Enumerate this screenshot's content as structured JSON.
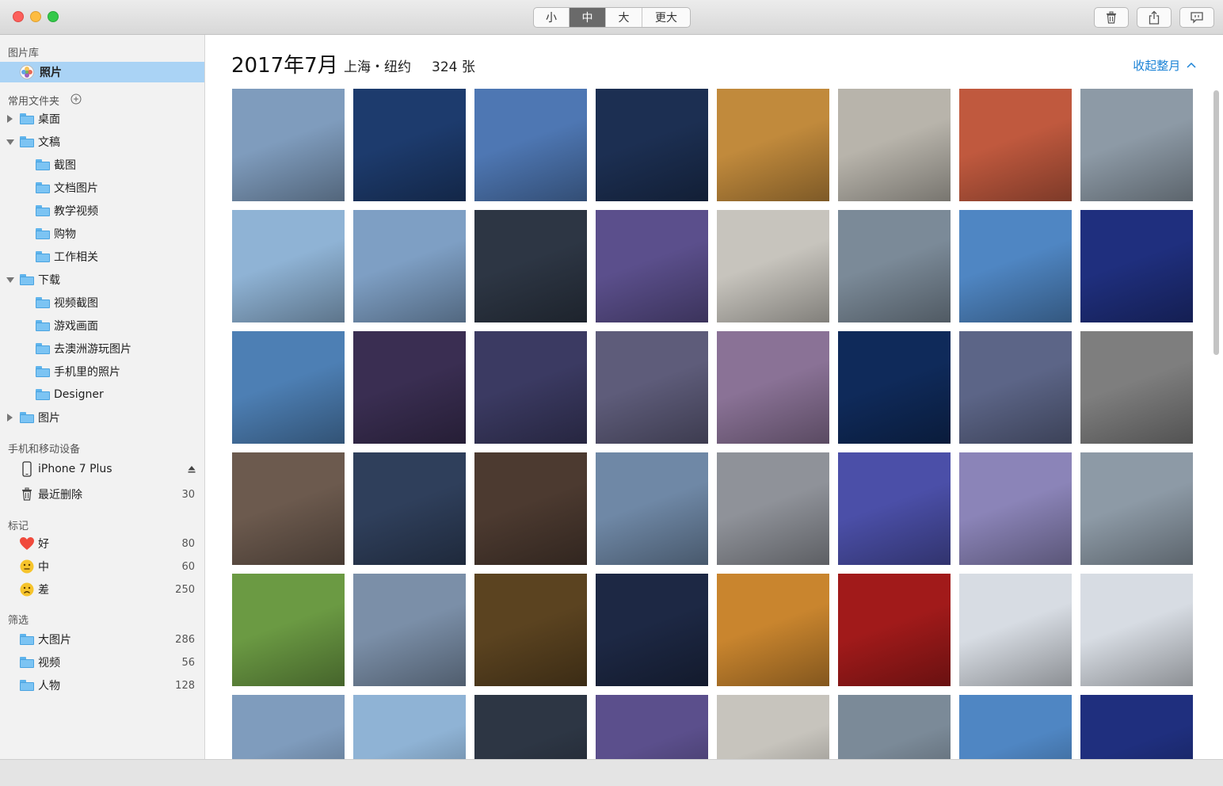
{
  "toolbar": {
    "sizes": [
      {
        "label": "小",
        "active": false
      },
      {
        "label": "中",
        "active": true
      },
      {
        "label": "大",
        "active": false
      },
      {
        "label": "更大",
        "active": false
      }
    ],
    "icons": [
      "trash-icon",
      "share-icon",
      "feedback-icon"
    ]
  },
  "sidebar": {
    "library_title": "图片库",
    "library_item": "照片",
    "favorites_title": "常用文件夹",
    "folders": [
      {
        "label": "桌面",
        "level": 0,
        "disclosure": "right"
      },
      {
        "label": "文稿",
        "level": 0,
        "disclosure": "down"
      },
      {
        "label": "截图",
        "level": 1
      },
      {
        "label": "文档图片",
        "level": 1
      },
      {
        "label": "教学视频",
        "level": 1
      },
      {
        "label": "购物",
        "level": 1
      },
      {
        "label": "工作相关",
        "level": 1
      },
      {
        "label": "下载",
        "level": 0,
        "disclosure": "down"
      },
      {
        "label": "视频截图",
        "level": 1
      },
      {
        "label": "游戏画面",
        "level": 1
      },
      {
        "label": "去澳洲游玩图片",
        "level": 1
      },
      {
        "label": "手机里的照片",
        "level": 1
      },
      {
        "label": "Designer",
        "level": 1
      },
      {
        "label": "图片",
        "level": 0,
        "disclosure": "right"
      }
    ],
    "devices_title": "手机和移动设备",
    "device": "iPhone 7 Plus",
    "deleted": {
      "label": "最近删除",
      "count": "30"
    },
    "tags_title": "标记",
    "tags": [
      {
        "label": "好",
        "count": "80",
        "icon": "heart-icon"
      },
      {
        "label": "中",
        "count": "60",
        "icon": "neutral-face-icon"
      },
      {
        "label": "差",
        "count": "250",
        "icon": "sad-face-icon"
      }
    ],
    "filters_title": "筛选",
    "filters": [
      {
        "label": "大图片",
        "count": "286"
      },
      {
        "label": "视频",
        "count": "56"
      },
      {
        "label": "人物",
        "count": "128"
      }
    ]
  },
  "main": {
    "title": "2017年7月",
    "location": "上海・纽约",
    "count": "324 张",
    "collapse": "收起整月",
    "photo_colors": [
      [
        "#7f9cbd",
        "#1d3b6d",
        "#4e77b3",
        "#1c2f52",
        "#c18a3c",
        "#b8b4ab",
        "#c0593e",
        "#8d9aa6"
      ],
      [
        "#8fb3d5",
        "#7e9fc4",
        "#2d3644",
        "#5b4f8c",
        "#c7c4bd",
        "#7b8a98",
        "#4f86c3",
        "#1f2f7e"
      ],
      [
        "#4d7fb4",
        "#3a2e52",
        "#3b3a62",
        "#5e5c7a",
        "#8a7296",
        "#0f2a5a",
        "#5c6587",
        "#7e7e7e"
      ],
      [
        "#6c5a4e",
        "#2f3f5b",
        "#4c3a30",
        "#6f88a6",
        "#8f9299",
        "#4b4fa8",
        "#8b84b8",
        "#8d9aa6"
      ],
      [
        "#6b9a43",
        "#7b8fa8",
        "#5b4320",
        "#1d2844",
        "#c9852e",
        "#a11a1a",
        "#d7dce3",
        "#d7dce3"
      ],
      [
        "#7f9cbd",
        "#8fb3d5",
        "#2d3644",
        "#5b4f8c",
        "#c7c4bd",
        "#7b8a98",
        "#4f86c3",
        "#1f2f7e"
      ]
    ]
  }
}
